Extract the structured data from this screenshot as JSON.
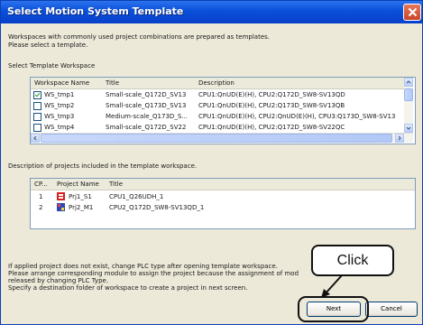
{
  "window": {
    "title": "Select Motion System Template"
  },
  "intro": {
    "line1": "Workspaces with commonly used project combinations are prepared as templates.",
    "line2": "Please select a template."
  },
  "workspace_section": {
    "label": "Select Template Workspace",
    "columns": [
      "Workspace Name",
      "Title",
      "Description"
    ],
    "rows": [
      {
        "name": "WS_tmp1",
        "title": "Small-scale_Q172D_SV13",
        "description": "CPU1:QnUD(E)(H), CPU2:Q172D_SW8-SV13QD",
        "checked": true
      },
      {
        "name": "WS_tmp2",
        "title": "Small-scale_Q173D_SV13",
        "description": "CPU1:QnUD(E)(H), CPU2:Q173D_SW8-SV13QB",
        "checked": false
      },
      {
        "name": "WS_tmp3",
        "title": "Medium-scale_Q173D_S...",
        "description": "CPU1:QnUD(E)(H), CPU2:QnUD(E)(H), CPU3:Q173D_SW8-SV13",
        "checked": false
      },
      {
        "name": "WS_tmp4",
        "title": "Small-scale_Q172D_SV22",
        "description": "CPU1:QnUD(E)(H), CPU2:Q172D_SW8-SV22QC",
        "checked": false
      }
    ]
  },
  "projects_section": {
    "label": "Description of projects included in the template workspace.",
    "columns": [
      "CP...",
      "Project Name",
      "Title"
    ],
    "rows": [
      {
        "cpu": "1",
        "name": "Prj1_S1",
        "title": "CPU1_Q26UDH_1",
        "icon": "plc-project-icon"
      },
      {
        "cpu": "2",
        "name": "Prj2_M1",
        "title": "CPU2_Q172D_SW8-SV13QD_1",
        "icon": "motion-project-icon"
      }
    ]
  },
  "notes": {
    "line1": "If applied project does not exist, change PLC type after opening template workspace.",
    "line2": "Please arrange corresponding module to assign the project because the assignment of mod",
    "line3": "released by changing PLC Type.",
    "line4": "Specify a destination folder of workspace to create a project in next screen."
  },
  "buttons": {
    "next": "Next",
    "cancel": "Cancel"
  },
  "annotation": {
    "callout": "Click"
  },
  "colors": {
    "titlebar": "#0a4fd9",
    "dialog_bg": "#ece9d8",
    "grid_border": "#7f9db9"
  }
}
